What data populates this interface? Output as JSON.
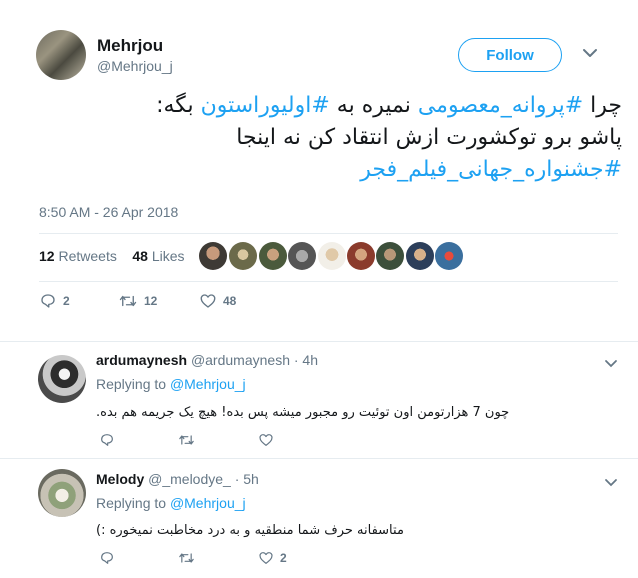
{
  "tweet": {
    "author_name": "Mehrjou",
    "author_handle": "@Mehrjou_j",
    "follow_label": "Follow",
    "text_lines": [
      {
        "parts": [
          {
            "t": "چرا ",
            "tag": false
          },
          {
            "t": "#پروانه_معصومی",
            "tag": true
          },
          {
            "t": " نمیره به ",
            "tag": false
          },
          {
            "t": "#اولیوراستون",
            "tag": true
          },
          {
            "t": " بگه:",
            "tag": false
          }
        ]
      },
      {
        "parts": [
          {
            "t": "پاشو برو توکشورت ازش انتقاد کن نه اینجا",
            "tag": false
          }
        ]
      },
      {
        "parts": [
          {
            "t": "#جشنواره_جهانی_فیلم_فجر",
            "tag": true
          }
        ]
      }
    ],
    "timestamp": "8:50 AM - 26 Apr 2018",
    "retweets_count": "12",
    "retweets_label": "Retweets",
    "likes_count": "48",
    "likes_label": "Likes",
    "action_counts": {
      "reply": "2",
      "retweet": "12",
      "like": "48"
    }
  },
  "replies": [
    {
      "name": "ardumaynesh",
      "handle": "@ardumaynesh",
      "time": "· 4h",
      "replying_prefix": "Replying to ",
      "replying_to": "@Mehrjou_j",
      "text": "چون 7 هزارتومن اون توئیت رو مجبور میشه پس بده! هیچ یک جریمه هم بده.",
      "like_count": ""
    },
    {
      "name": "Melody",
      "handle": "@_melodye_",
      "time": "· 5h",
      "replying_prefix": "Replying to ",
      "replying_to": "@Mehrjou_j",
      "text": "متاسفانه حرف شما منطقیه و به درد مخاطبت نمیخوره :)",
      "like_count": "2"
    }
  ],
  "icons": {
    "reply": "reply-icon",
    "retweet": "retweet-icon",
    "like": "heart-icon",
    "more": "chevron-down-icon"
  },
  "colors": {
    "accent": "#1da1f2",
    "muted": "#657786",
    "text": "#14171a",
    "border": "#e6ecf0"
  }
}
